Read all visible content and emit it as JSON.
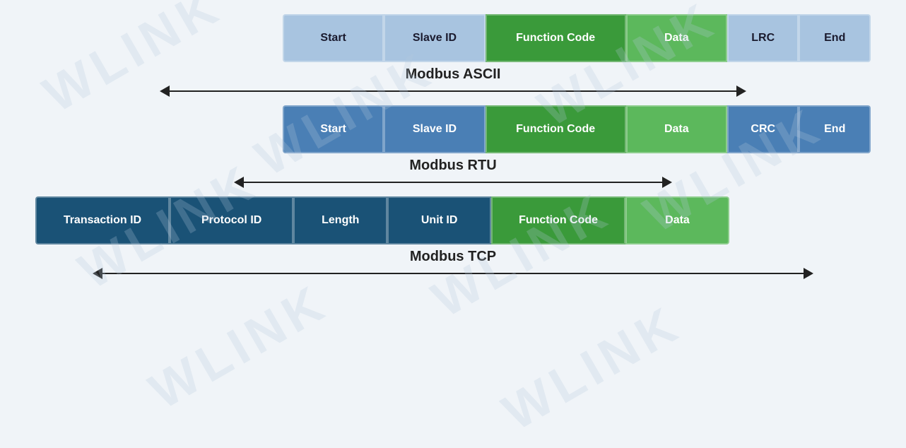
{
  "watermark": {
    "texts": [
      "WLINK",
      "WLINK",
      "WLINK",
      "WLINK",
      "WLINK",
      "WLINK"
    ]
  },
  "protocols": {
    "ascii": {
      "label": "Modbus ASCII",
      "cells": [
        {
          "id": "start",
          "label": "Start",
          "type": "light-blue",
          "flex": 1
        },
        {
          "id": "slave-id",
          "label": "Slave ID",
          "type": "light-blue",
          "flex": 1
        },
        {
          "id": "function-code",
          "label": "Function Code",
          "type": "green-fc",
          "flex": 1.4
        },
        {
          "id": "data",
          "label": "Data",
          "type": "green-data",
          "flex": 1
        },
        {
          "id": "lrc",
          "label": "LRC",
          "type": "light-blue",
          "flex": 0.7
        },
        {
          "id": "end",
          "label": "End",
          "type": "light-blue",
          "flex": 0.7
        }
      ]
    },
    "rtu": {
      "label": "Modbus RTU",
      "cells": [
        {
          "id": "start",
          "label": "Start",
          "type": "blue",
          "flex": 1
        },
        {
          "id": "slave-id",
          "label": "Slave ID",
          "type": "blue",
          "flex": 1
        },
        {
          "id": "function-code",
          "label": "Function Code",
          "type": "green-fc",
          "flex": 1.4
        },
        {
          "id": "data",
          "label": "Data",
          "type": "green-data",
          "flex": 1
        },
        {
          "id": "crc",
          "label": "CRC",
          "type": "blue",
          "flex": 0.7
        },
        {
          "id": "end",
          "label": "End",
          "type": "blue",
          "flex": 0.7
        }
      ]
    },
    "tcp": {
      "label": "Modbus TCP",
      "cells": [
        {
          "id": "transaction-id",
          "label": "Transaction ID",
          "type": "dark-blue",
          "flex": 1.3
        },
        {
          "id": "protocol-id",
          "label": "Protocol ID",
          "type": "dark-blue",
          "flex": 1.2
        },
        {
          "id": "length",
          "label": "Length",
          "type": "dark-blue",
          "flex": 0.9
        },
        {
          "id": "unit-id",
          "label": "Unit ID",
          "type": "dark-blue",
          "flex": 1
        },
        {
          "id": "function-code",
          "label": "Function Code",
          "type": "green-fc",
          "flex": 1.3
        },
        {
          "id": "data",
          "label": "Data",
          "type": "green-data",
          "flex": 1
        }
      ]
    }
  }
}
